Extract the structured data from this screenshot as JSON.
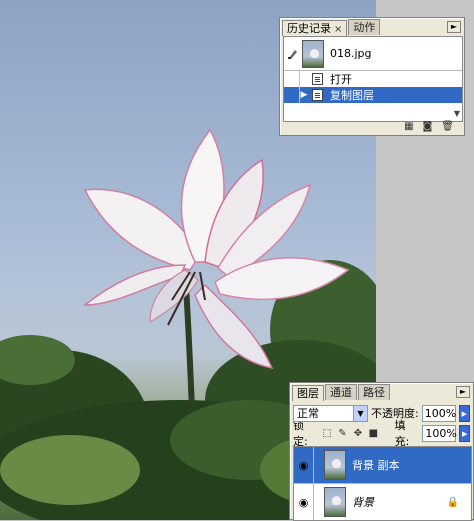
{
  "history_panel": {
    "tabs": [
      {
        "label": "历史记录",
        "close": "×",
        "active": true
      },
      {
        "label": "动作",
        "active": false
      }
    ],
    "menu_glyph": "►",
    "snapshot": {
      "name": "018.jpg"
    },
    "states": [
      {
        "label": "打开",
        "selected": false
      },
      {
        "label": "复制图层",
        "selected": true
      }
    ]
  },
  "layers_panel": {
    "tabs": [
      {
        "label": "图层",
        "active": true
      },
      {
        "label": "通道",
        "active": false
      },
      {
        "label": "路径",
        "active": false
      }
    ],
    "menu_glyph": "►",
    "blend_mode": "正常",
    "opacity_label": "不透明度:",
    "opacity_value": "100%",
    "lock_label": "锁定:",
    "fill_label": "填充:",
    "fill_value": "100%",
    "layers": [
      {
        "name": "背景 副本",
        "visible": true,
        "selected": true,
        "locked": false,
        "italic": false
      },
      {
        "name": "背景",
        "visible": true,
        "selected": false,
        "locked": true,
        "italic": true
      }
    ]
  },
  "colors": {
    "selection": "#316ac5",
    "palette_bg": "#ece9d8",
    "workspace": "#c6c6c6"
  }
}
